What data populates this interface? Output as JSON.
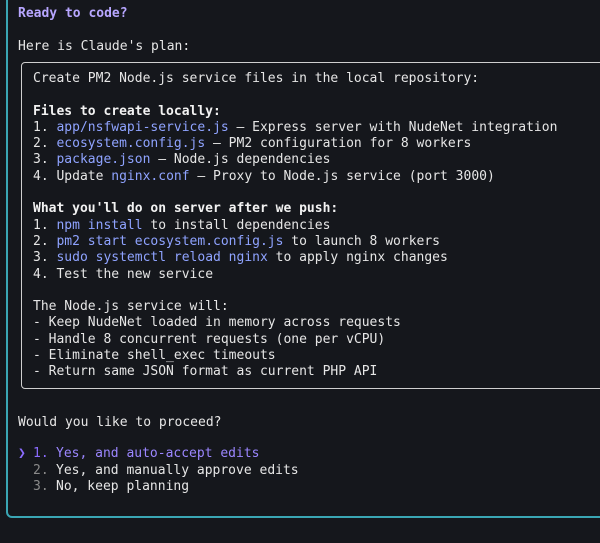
{
  "header": {
    "title": "Ready to code?"
  },
  "intro": "Here is Claude's plan:",
  "plan": {
    "opening": "Create PM2 Node.js service files in the local repository:",
    "files_heading": "Files to create locally:",
    "files": [
      {
        "num": "1.",
        "pre": "",
        "code": "app/nsfwapi-service.js",
        "post": " – Express server with NudeNet integration"
      },
      {
        "num": "2.",
        "pre": "",
        "code": "ecosystem.config.js",
        "post": " – PM2 configuration for 8 workers"
      },
      {
        "num": "3.",
        "pre": "",
        "code": "package.json",
        "post": " – Node.js dependencies"
      },
      {
        "num": "4.",
        "pre": "Update ",
        "code": "nginx.conf",
        "post": " – Proxy to Node.js service (port 3000)"
      }
    ],
    "server_heading": "What you'll do on server after we push:",
    "server_steps": [
      {
        "num": "1.",
        "code": "npm install",
        "post": " to install dependencies"
      },
      {
        "num": "2.",
        "code": "pm2 start ecosystem.config.js",
        "post": " to launch 8 workers"
      },
      {
        "num": "3.",
        "code": "sudo systemctl reload nginx",
        "post": " to apply nginx changes"
      },
      {
        "num": "4.",
        "code": "",
        "post": "Test the new service"
      }
    ],
    "service_heading": "The Node.js service will:",
    "service_points": [
      "- Keep NudeNet loaded in memory across requests",
      "- Handle 8 concurrent requests (one per vCPU)",
      "- Eliminate shell_exec timeouts",
      "- Return same JSON format as current PHP API"
    ]
  },
  "question": "Would you like to proceed?",
  "options": [
    {
      "caret": "❯",
      "num": "1.",
      "label": "Yes, and auto-accept edits"
    },
    {
      "caret": "",
      "num": "2.",
      "label": "Yes, and manually approve edits"
    },
    {
      "caret": "",
      "num": "3.",
      "label": "No, keep planning"
    }
  ],
  "colors": {
    "accent": "#8b6cff",
    "code": "#8fa3ff",
    "frame": "#3aa6b4",
    "background": "#15171c"
  }
}
